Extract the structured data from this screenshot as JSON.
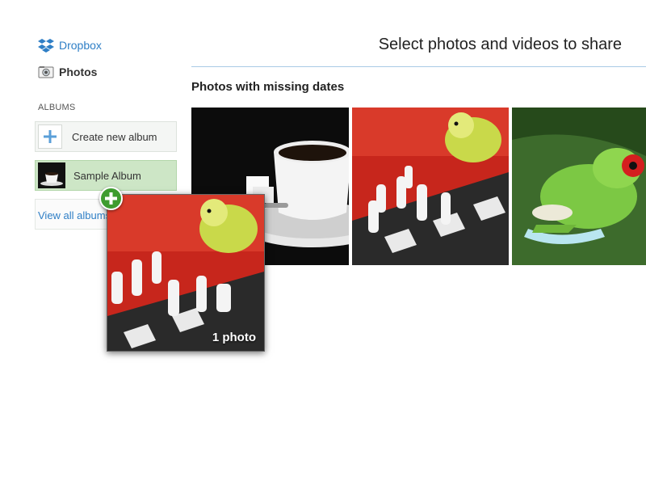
{
  "sidebar": {
    "dropbox_label": "Dropbox",
    "photos_label": "Photos",
    "albums_header": "ALBUMS",
    "albums": [
      {
        "label": "Create new album"
      },
      {
        "label": "Sample Album"
      }
    ],
    "view_all_label": "View all albums"
  },
  "main": {
    "title": "Select photos and videos to share",
    "section_title": "Photos with missing dates",
    "photos": [
      {
        "icon": "coffee-cup-photo"
      },
      {
        "icon": "parakeet-chess-photo"
      },
      {
        "icon": "tree-frog-photo"
      }
    ]
  },
  "drag": {
    "count_label": "1 photo",
    "badge_icon": "plus-icon"
  },
  "colors": {
    "link": "#2f7fc6",
    "selected_album": "#cde6c6",
    "badge": "#3e9c2f",
    "rule": "#a9cbe6"
  }
}
